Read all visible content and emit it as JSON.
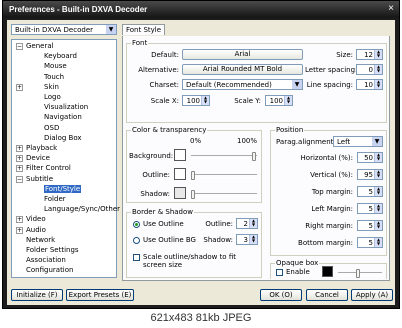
{
  "window": {
    "title": "Preferences - Built-in DXVA Decoder",
    "close_glyph": "×"
  },
  "filter_select": "Built-in DXVA Decoder",
  "tree": {
    "items": [
      {
        "label": "General",
        "toggle": "−"
      },
      {
        "label": "Keyboard"
      },
      {
        "label": "Mouse"
      },
      {
        "label": "Touch"
      },
      {
        "label": "Skin",
        "toggle": "+"
      },
      {
        "label": "Logo"
      },
      {
        "label": "Visualization"
      },
      {
        "label": "Navigation"
      },
      {
        "label": "OSD"
      },
      {
        "label": "Dialog Box"
      },
      {
        "label": "Playback",
        "toggle": "+"
      },
      {
        "label": "Device",
        "toggle": "+"
      },
      {
        "label": "Filter Control",
        "toggle": "+"
      },
      {
        "label": "Subtitle",
        "toggle": "−"
      },
      {
        "label": "Font/Style"
      },
      {
        "label": "Folder"
      },
      {
        "label": "Language/Sync/Other"
      },
      {
        "label": "Video",
        "toggle": "+"
      },
      {
        "label": "Audio",
        "toggle": "+"
      },
      {
        "label": "Network"
      },
      {
        "label": "Folder Settings"
      },
      {
        "label": "Association"
      },
      {
        "label": "Configuration"
      }
    ]
  },
  "tab": "Font Style",
  "font": {
    "group": "Font",
    "default_label": "Default:",
    "default_value": "Arial",
    "alternative_label": "Alternative:",
    "alternative_value": "Arial Rounded MT Bold",
    "charset_label": "Charset:",
    "charset_value": "Default (Recommended)",
    "scalex_label": "Scale X:",
    "scalex_value": "100",
    "scaley_label": "Scale Y:",
    "scaley_value": "100",
    "size_label": "Size:",
    "size_value": "12",
    "letter_label": "Letter spacing:",
    "letter_value": "0",
    "line_label": "Line spacing:",
    "line_value": "10"
  },
  "color": {
    "group": "Color & transparency",
    "pct_min": "0%",
    "pct_max": "100%",
    "background_label": "Background:",
    "outline_label": "Outline:",
    "shadow_label": "Shadow:",
    "background_color": "#ffffff",
    "outline_color": "#ffffff",
    "shadow_color": "#e8e8e8",
    "background_level": 1.0,
    "outline_level": 0.0,
    "shadow_level": 0.0
  },
  "border": {
    "group": "Border & Shadow",
    "use_outline": "Use Outline",
    "use_outline_bg": "Use Outline BG",
    "outline_label": "Outline:",
    "outline_value": "2",
    "shadow_label": "Shadow:",
    "shadow_value": "3",
    "scale_check": "Scale outline/shadow to fit screen size"
  },
  "position": {
    "group": "Position",
    "parag_label": "Parag.alignment:",
    "parag_value": "Left",
    "horizontal_label": "Horizontal (%):",
    "horizontal_value": "50",
    "vertical_label": "Vertical (%):",
    "vertical_value": "95",
    "top_label": "Top margin:",
    "top_value": "5",
    "left_label": "Left Margin:",
    "left_value": "5",
    "right_label": "Right margin:",
    "right_value": "5",
    "bottom_label": "Bottom margin:",
    "bottom_value": "5"
  },
  "opaque": {
    "group": "Opaque box",
    "enable": "Enable",
    "color": "#000000",
    "level": 0.45
  },
  "buttons": {
    "initialize": "Initialize (F)",
    "export": "Export Presets (E)",
    "ok": "OK (O)",
    "cancel": "Cancel",
    "apply": "Apply (A)"
  },
  "footer": "621x483  81kb  JPEG"
}
